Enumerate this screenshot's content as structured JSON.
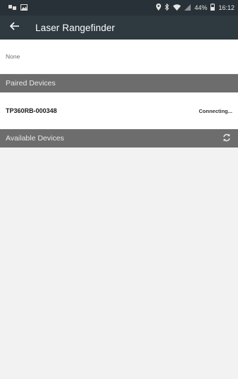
{
  "status_bar": {
    "battery": "44%",
    "time": "16:12",
    "icons": [
      "notification-icon",
      "image-icon",
      "location-icon",
      "bluetooth-icon",
      "wifi-icon",
      "signal-icon",
      "battery-icon"
    ]
  },
  "app_bar": {
    "title": "Laser Rangefinder",
    "back_icon": "back-arrow-icon"
  },
  "connected": {
    "label": "None"
  },
  "paired": {
    "header": "Paired Devices",
    "devices": [
      {
        "name": "TP360RB-000348",
        "status": "Connecting..."
      }
    ]
  },
  "available": {
    "header": "Available Devices",
    "refresh_icon": "refresh-icon"
  },
  "colors": {
    "status_bar": "#283138",
    "app_bar": "#2e3940",
    "section_header": "#6d6d6d",
    "background": "#f2f2f2"
  }
}
